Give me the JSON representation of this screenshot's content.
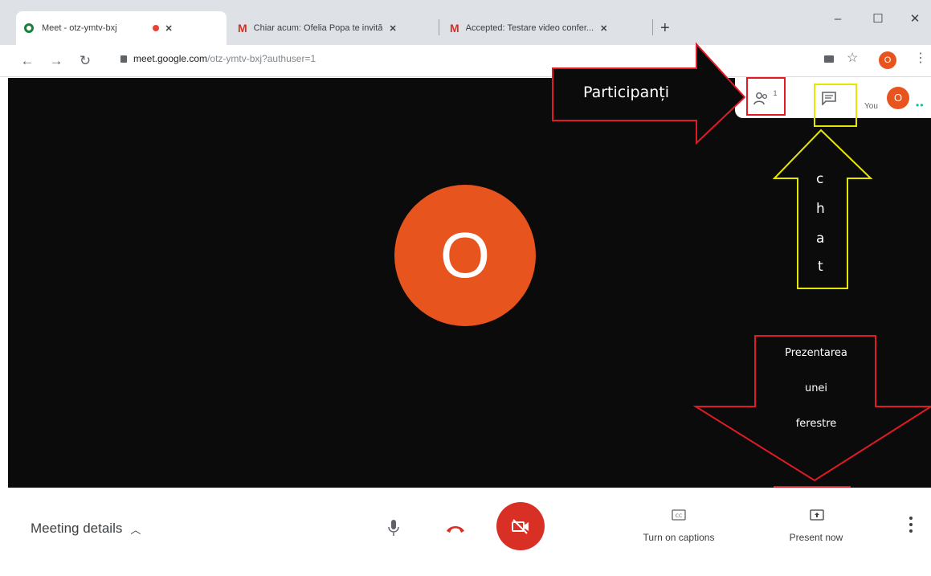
{
  "browser": {
    "tabs": [
      {
        "title": "Meet - otz-ymtv-bxj",
        "active": true
      },
      {
        "title": "Chiar acum: Ofelia Popa te invită",
        "active": false
      },
      {
        "title": "Accepted: Testare video confer...",
        "active": false
      }
    ],
    "new_tab_label": "+",
    "window_controls": {
      "minimize": "–",
      "maximize": "☐",
      "close": "✕"
    },
    "url_host": "meet.google.com",
    "url_path": "/otz-ymtv-bxj?authuser=1",
    "profile_initial": "O"
  },
  "meeting": {
    "participant_initial": "O",
    "participants_count": "1",
    "self_label": "You",
    "self_initial": "O"
  },
  "annotations": {
    "participants": "Participanți",
    "chat_letters": [
      "c",
      "h",
      "a",
      "t"
    ],
    "present_lines": [
      "Prezentarea",
      "unei",
      "ferestre"
    ]
  },
  "controls": {
    "meeting_details": "Meeting details",
    "captions_label": "Turn on captions",
    "present_label": "Present now"
  },
  "colors": {
    "accent_orange": "#e8541e",
    "end_call_red": "#d93025",
    "annotation_red": "#e01b24",
    "annotation_yellow": "#e6e600"
  }
}
